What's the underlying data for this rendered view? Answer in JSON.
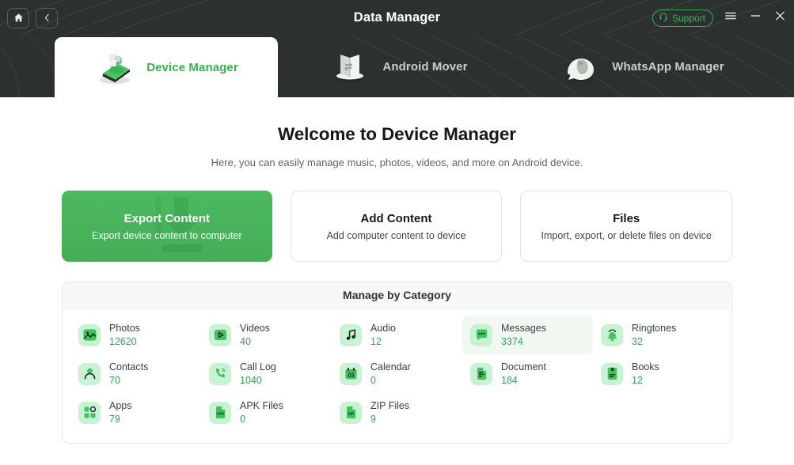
{
  "titlebar": {
    "title": "Data Manager",
    "home_icon": "home-icon",
    "back_icon": "back-chevron-icon",
    "support_label": "Support",
    "support_icon": "headset-icon",
    "menu_icon": "hamburger-menu-icon",
    "minimize_icon": "minimize-icon",
    "close_icon": "close-icon",
    "accent": "#44b35b",
    "background": "#2c312f"
  },
  "tabs": [
    {
      "label": "Device Manager",
      "icon": "device-phone-icon",
      "active": true
    },
    {
      "label": "Android Mover",
      "icon": "android-mover-icon",
      "active": false
    },
    {
      "label": "WhatsApp Manager",
      "icon": "whatsapp-icon",
      "active": false
    }
  ],
  "main": {
    "welcome_title": "Welcome to Device Manager",
    "welcome_subtitle": "Here, you can easily manage music, photos, videos, and more on Android device."
  },
  "action_cards": [
    {
      "title": "Export Content",
      "subtitle": "Export device content to computer",
      "primary": true,
      "watermark_icon": "download-arrow-icon"
    },
    {
      "title": "Add Content",
      "subtitle": "Add computer content to device",
      "primary": false
    },
    {
      "title": "Files",
      "subtitle": "Import, export, or delete files on device",
      "primary": false
    }
  ],
  "category_panel": {
    "header": "Manage by Category",
    "rows": [
      [
        {
          "label": "Photos",
          "count": "12620",
          "icon": "photo-icon",
          "highlight": false
        },
        {
          "label": "Videos",
          "count": "40",
          "icon": "video-icon",
          "highlight": false
        },
        {
          "label": "Audio",
          "count": "12",
          "icon": "audio-icon",
          "highlight": false
        },
        {
          "label": "Messages",
          "count": "3374",
          "icon": "messages-icon",
          "highlight": true
        },
        {
          "label": "Ringtones",
          "count": "32",
          "icon": "ringtone-icon",
          "highlight": false
        }
      ],
      [
        {
          "label": "Contacts",
          "count": "70",
          "icon": "contacts-icon",
          "highlight": false
        },
        {
          "label": "Call Log",
          "count": "1040",
          "icon": "calllog-icon",
          "highlight": false
        },
        {
          "label": "Calendar",
          "count": "0",
          "icon": "calendar-icon",
          "highlight": false
        },
        {
          "label": "Document",
          "count": "184",
          "icon": "document-icon",
          "highlight": false
        },
        {
          "label": "Books",
          "count": "12",
          "icon": "books-icon",
          "highlight": false
        }
      ],
      [
        {
          "label": "Apps",
          "count": "79",
          "icon": "apps-icon",
          "highlight": false
        },
        {
          "label": "APK Files",
          "count": "0",
          "icon": "apk-file-icon",
          "highlight": false
        },
        {
          "label": "ZIP Files",
          "count": "9",
          "icon": "zip-file-icon",
          "highlight": false
        }
      ]
    ],
    "calendar_day": "03",
    "apk_label": "APK",
    "zip_label": "ZIP"
  }
}
